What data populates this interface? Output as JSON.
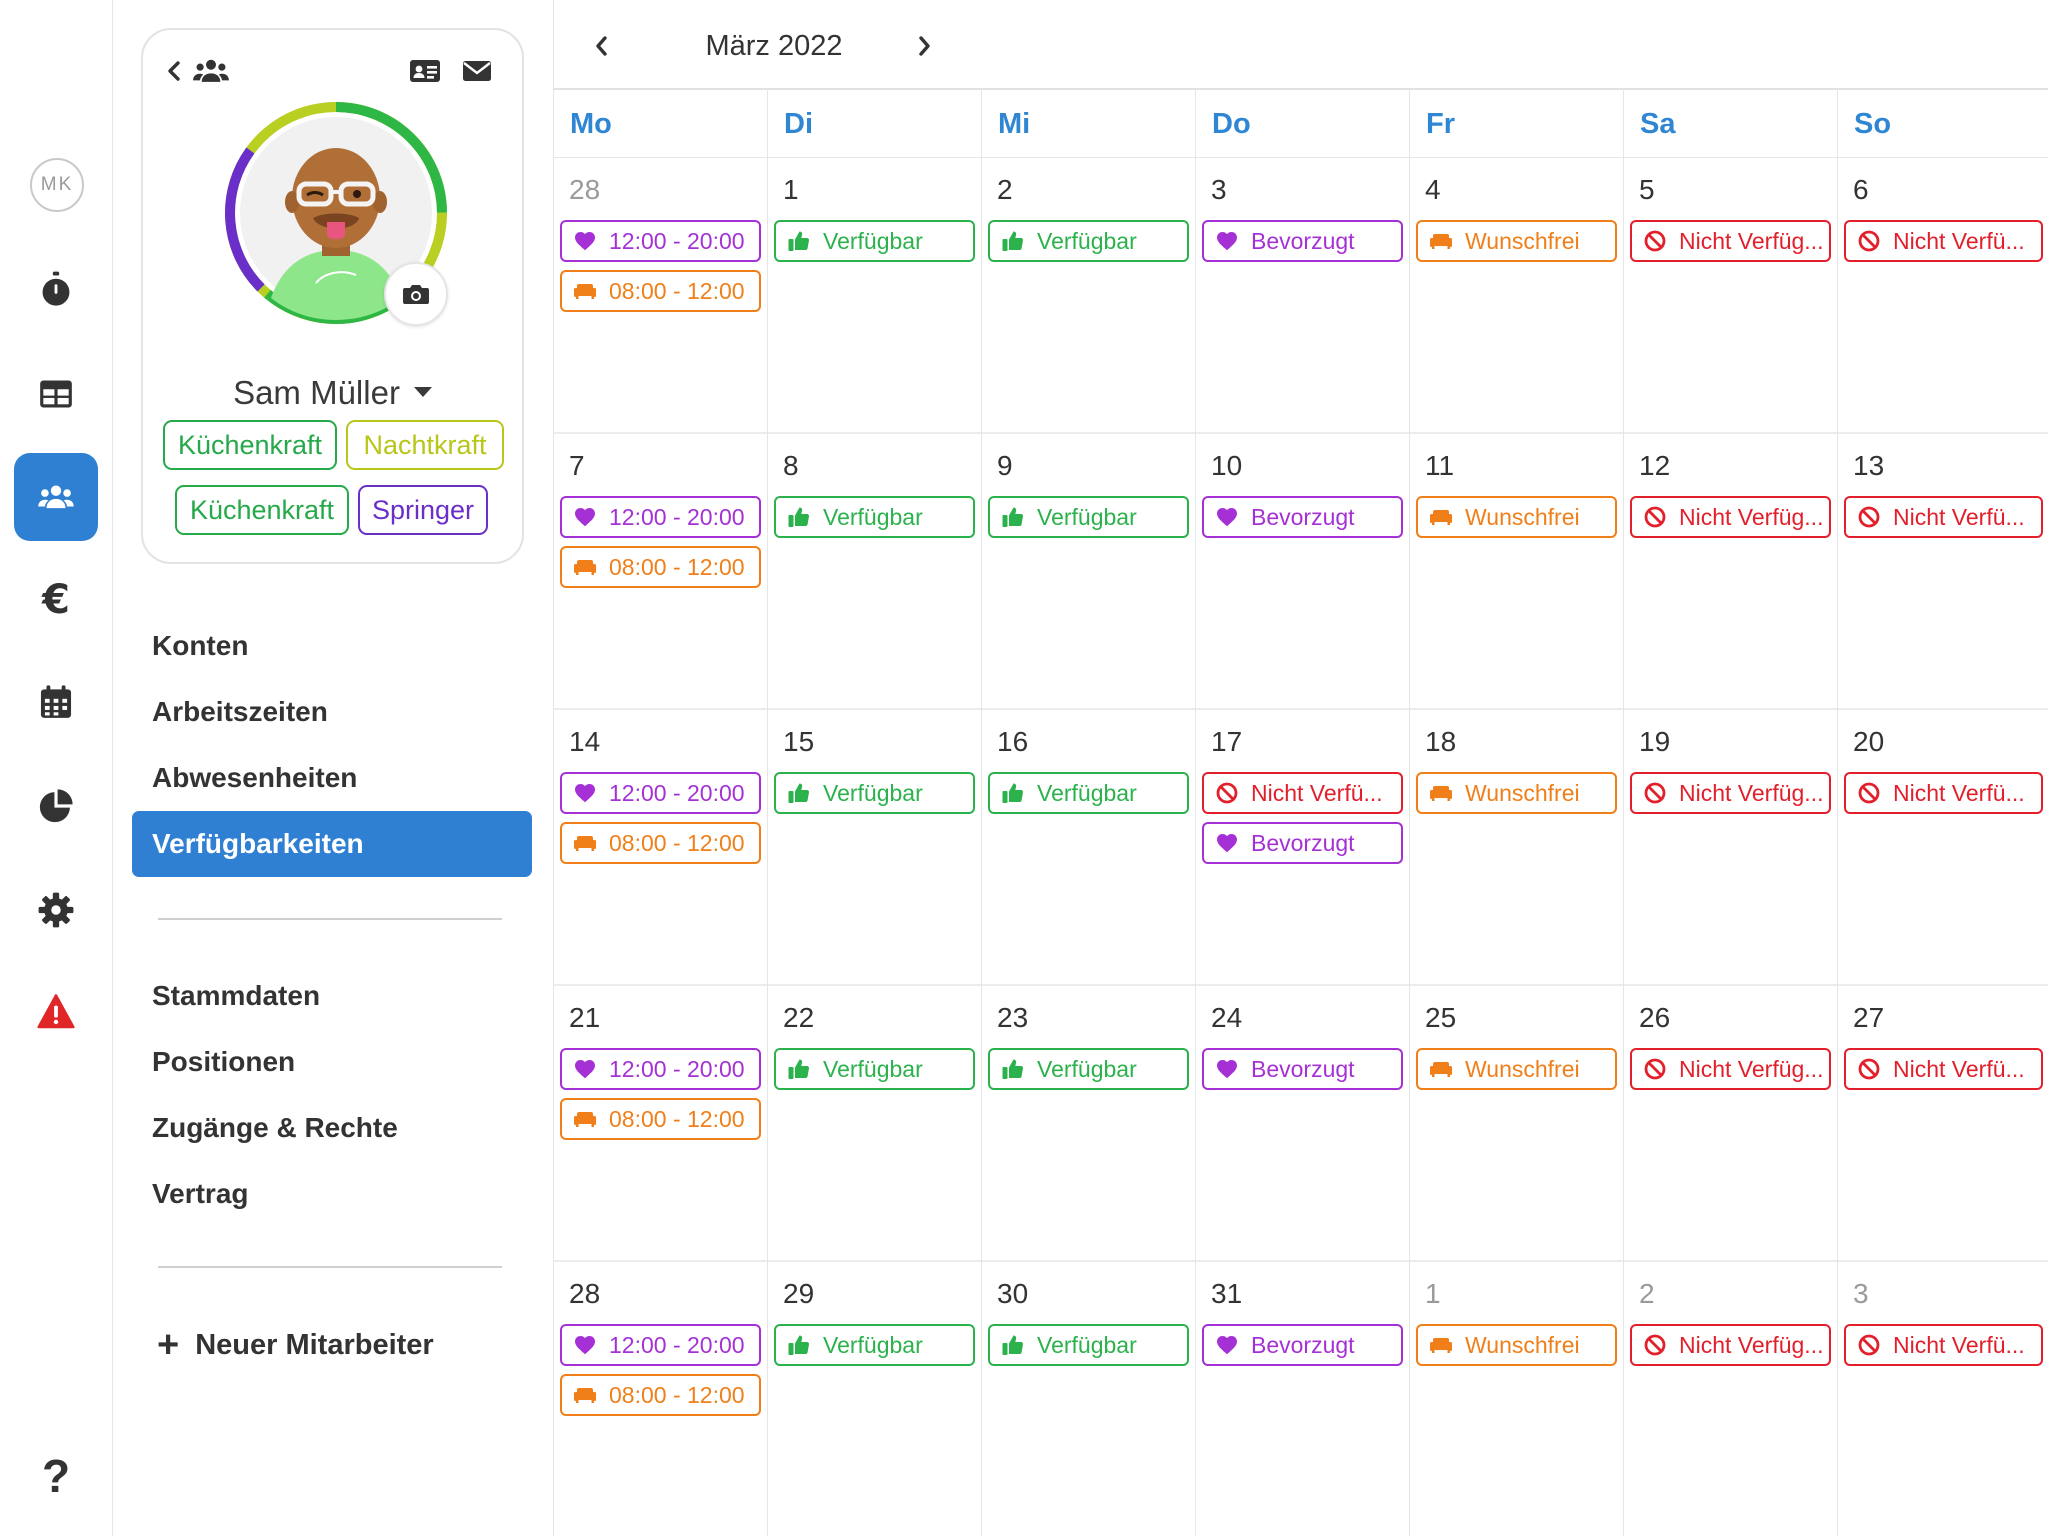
{
  "rail": {
    "user_initials": "MK",
    "items": [
      {
        "icon": "stopwatch-icon"
      },
      {
        "icon": "table-icon"
      },
      {
        "icon": "users-icon",
        "active": true
      },
      {
        "icon": "euro-icon",
        "symbol": "€"
      },
      {
        "icon": "calendar-icon"
      },
      {
        "icon": "pie-chart-icon"
      },
      {
        "icon": "gear-icon"
      },
      {
        "icon": "warning-icon"
      },
      {
        "icon": "help-icon",
        "symbol": "?"
      }
    ]
  },
  "profile": {
    "name": "Sam Müller",
    "tags": [
      {
        "label": "Küchenkraft",
        "color": "#26a94a"
      },
      {
        "label": "Nachtkraft",
        "color": "#b8c61a"
      },
      {
        "label": "Küchenkraft",
        "color": "#26a94a"
      },
      {
        "label": "Springer",
        "color": "#6a2fc9"
      }
    ]
  },
  "menu": {
    "group1": [
      "Konten",
      "Arbeitszeiten",
      "Abwesenheiten",
      "Verfügbarkeiten"
    ],
    "active": "Verfügbarkeiten",
    "group2": [
      "Stammdaten",
      "Positionen",
      "Zugänge & Rechte",
      "Vertrag"
    ],
    "new_employee": "Neuer Mitarbeiter"
  },
  "calendar": {
    "month": "März 2022",
    "weekdays": [
      "Mo",
      "Di",
      "Mi",
      "Do",
      "Fr",
      "Sa",
      "So"
    ],
    "legend_colors": {
      "time": "#a531d6",
      "absence": "#f07f1a",
      "available": "#2bb24c",
      "preferred": "#a531d6",
      "wishfree": "#f07f1a",
      "unavailable": "#e2202c"
    },
    "weeks": [
      [
        {
          "day": "28",
          "muted": true,
          "entries": [
            {
              "type": "time",
              "label": "12:00 - 20:00"
            },
            {
              "type": "absence",
              "label": "08:00 - 12:00"
            }
          ]
        },
        {
          "day": "1",
          "entries": [
            {
              "type": "available",
              "label": "Verfügbar"
            }
          ]
        },
        {
          "day": "2",
          "entries": [
            {
              "type": "available",
              "label": "Verfügbar"
            }
          ]
        },
        {
          "day": "3",
          "entries": [
            {
              "type": "preferred",
              "label": "Bevorzugt"
            }
          ]
        },
        {
          "day": "4",
          "entries": [
            {
              "type": "wishfree",
              "label": "Wunschfrei"
            }
          ]
        },
        {
          "day": "5",
          "entries": [
            {
              "type": "unavailable",
              "label": "Nicht Verfüg..."
            }
          ]
        },
        {
          "day": "6",
          "entries": [
            {
              "type": "unavailable",
              "label": "Nicht Verfü..."
            }
          ]
        }
      ],
      [
        {
          "day": "7",
          "entries": [
            {
              "type": "time",
              "label": "12:00 - 20:00"
            },
            {
              "type": "absence",
              "label": "08:00 - 12:00"
            }
          ]
        },
        {
          "day": "8",
          "entries": [
            {
              "type": "available",
              "label": "Verfügbar"
            }
          ]
        },
        {
          "day": "9",
          "entries": [
            {
              "type": "available",
              "label": "Verfügbar"
            }
          ]
        },
        {
          "day": "10",
          "entries": [
            {
              "type": "preferred",
              "label": "Bevorzugt"
            }
          ]
        },
        {
          "day": "11",
          "entries": [
            {
              "type": "wishfree",
              "label": "Wunschfrei"
            }
          ]
        },
        {
          "day": "12",
          "entries": [
            {
              "type": "unavailable",
              "label": "Nicht Verfüg..."
            }
          ]
        },
        {
          "day": "13",
          "entries": [
            {
              "type": "unavailable",
              "label": "Nicht Verfü..."
            }
          ]
        }
      ],
      [
        {
          "day": "14",
          "entries": [
            {
              "type": "time",
              "label": "12:00 - 20:00"
            },
            {
              "type": "absence",
              "label": "08:00 - 12:00"
            }
          ]
        },
        {
          "day": "15",
          "entries": [
            {
              "type": "available",
              "label": "Verfügbar"
            }
          ]
        },
        {
          "day": "16",
          "entries": [
            {
              "type": "available",
              "label": "Verfügbar"
            }
          ]
        },
        {
          "day": "17",
          "entries": [
            {
              "type": "unavailable",
              "label": "Nicht Verfü..."
            },
            {
              "type": "preferred",
              "label": "Bevorzugt"
            }
          ]
        },
        {
          "day": "18",
          "entries": [
            {
              "type": "wishfree",
              "label": "Wunschfrei"
            }
          ]
        },
        {
          "day": "19",
          "entries": [
            {
              "type": "unavailable",
              "label": "Nicht Verfüg..."
            }
          ]
        },
        {
          "day": "20",
          "entries": [
            {
              "type": "unavailable",
              "label": "Nicht Verfü..."
            }
          ]
        }
      ],
      [
        {
          "day": "21",
          "entries": [
            {
              "type": "time",
              "label": "12:00 - 20:00"
            },
            {
              "type": "absence",
              "label": "08:00 - 12:00"
            }
          ]
        },
        {
          "day": "22",
          "entries": [
            {
              "type": "available",
              "label": "Verfügbar"
            }
          ]
        },
        {
          "day": "23",
          "entries": [
            {
              "type": "available",
              "label": "Verfügbar"
            }
          ]
        },
        {
          "day": "24",
          "entries": [
            {
              "type": "preferred",
              "label": "Bevorzugt"
            }
          ]
        },
        {
          "day": "25",
          "entries": [
            {
              "type": "wishfree",
              "label": "Wunschfrei"
            }
          ]
        },
        {
          "day": "26",
          "entries": [
            {
              "type": "unavailable",
              "label": "Nicht Verfüg..."
            }
          ]
        },
        {
          "day": "27",
          "entries": [
            {
              "type": "unavailable",
              "label": "Nicht Verfü..."
            }
          ]
        }
      ],
      [
        {
          "day": "28",
          "entries": [
            {
              "type": "time",
              "label": "12:00 - 20:00"
            },
            {
              "type": "absence",
              "label": "08:00 - 12:00"
            }
          ]
        },
        {
          "day": "29",
          "entries": [
            {
              "type": "available",
              "label": "Verfügbar"
            }
          ]
        },
        {
          "day": "30",
          "entries": [
            {
              "type": "available",
              "label": "Verfügbar"
            }
          ]
        },
        {
          "day": "31",
          "entries": [
            {
              "type": "preferred",
              "label": "Bevorzugt"
            }
          ]
        },
        {
          "day": "1",
          "muted": true,
          "entries": [
            {
              "type": "wishfree",
              "label": "Wunschfrei"
            }
          ]
        },
        {
          "day": "2",
          "muted": true,
          "entries": [
            {
              "type": "unavailable",
              "label": "Nicht Verfüg..."
            }
          ]
        },
        {
          "day": "3",
          "muted": true,
          "entries": [
            {
              "type": "unavailable",
              "label": "Nicht Verfü..."
            }
          ]
        }
      ]
    ]
  }
}
